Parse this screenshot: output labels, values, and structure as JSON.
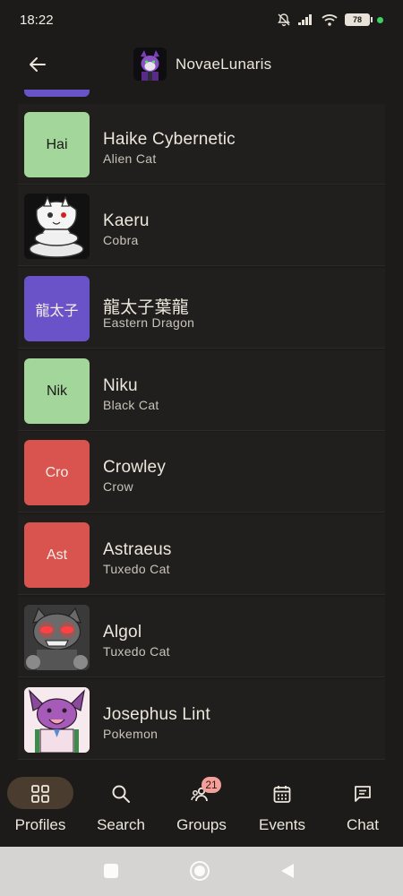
{
  "status": {
    "time": "18:22",
    "battery": "78"
  },
  "header": {
    "title": "NovaeLunaris"
  },
  "colors": {
    "purple": "#6a52c8",
    "green": "#a3d69a",
    "red": "#d9534f",
    "accent_pill": "#4a3c2e",
    "badge": "#f4a09a"
  },
  "profiles": [
    {
      "name": "Haike Cybernetic",
      "species": "Alien Cat",
      "avatar": "Hai"
    },
    {
      "name": "Kaeru",
      "species": "Cobra",
      "avatar": ""
    },
    {
      "name": "龍太子葉龍",
      "species": "Eastern Dragon",
      "avatar": "龍太子"
    },
    {
      "name": "Niku",
      "species": "Black Cat",
      "avatar": "Nik"
    },
    {
      "name": "Crowley",
      "species": "Crow",
      "avatar": "Cro"
    },
    {
      "name": "Astraeus",
      "species": "Tuxedo Cat",
      "avatar": "Ast"
    },
    {
      "name": "Algol",
      "species": "Tuxedo Cat",
      "avatar": ""
    },
    {
      "name": "Josephus Lint",
      "species": "Pokemon",
      "avatar": ""
    }
  ],
  "nav": {
    "profiles": "Profiles",
    "search": "Search",
    "groups": "Groups",
    "groups_badge": "21",
    "events": "Events",
    "chat": "Chat",
    "active": "profiles"
  }
}
